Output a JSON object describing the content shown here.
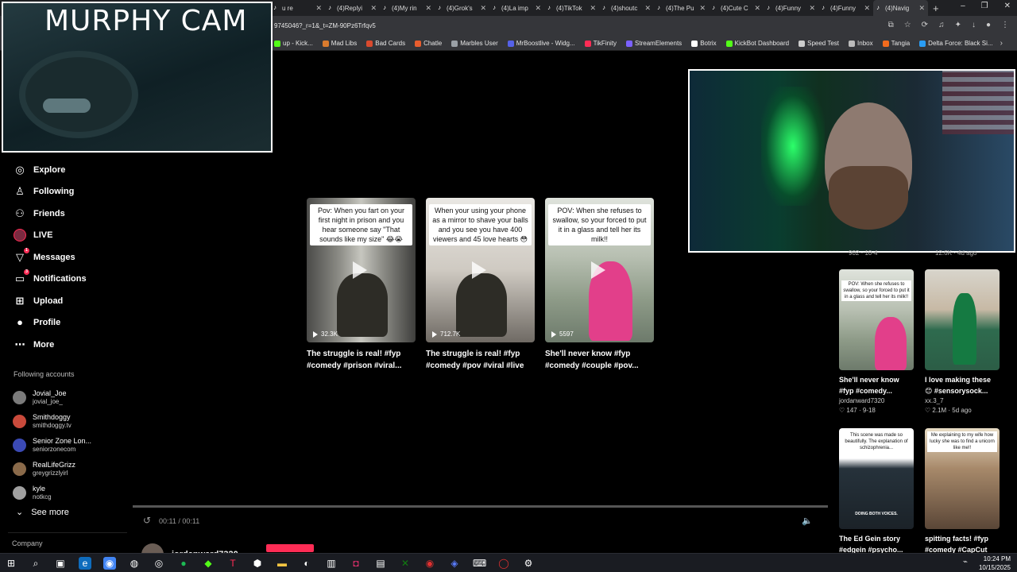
{
  "browser": {
    "tabs": [
      {
        "title": "u re"
      },
      {
        "title": "(4)Replyi"
      },
      {
        "title": "(4)My rin"
      },
      {
        "title": "(4)Grok's"
      },
      {
        "title": "(4)La imp"
      },
      {
        "title": "(4)TikTok"
      },
      {
        "title": "(4)shoutc"
      },
      {
        "title": "(4)The Pu"
      },
      {
        "title": "(4)Cute C"
      },
      {
        "title": "(4)Funny"
      },
      {
        "title": "(4)Funny"
      },
      {
        "title": "(4)Navig"
      }
    ],
    "url": "9745046?_r=1&_t=ZM-90Pz6Trfqv5",
    "bookmarks": [
      {
        "label": "up - Kick...",
        "color": "#53fc18"
      },
      {
        "label": "Mad Libs",
        "color": "#d97b2e"
      },
      {
        "label": "Bad Cards",
        "color": "#d94a2e"
      },
      {
        "label": "Chatle",
        "color": "#e85d2e"
      },
      {
        "label": "Marbles User",
        "color": "#9aa0a6"
      },
      {
        "label": "MrBoostlive - Widg...",
        "color": "#5561e8"
      },
      {
        "label": "TikFinity",
        "color": "#fe2c55"
      },
      {
        "label": "StreamElements",
        "color": "#7b61ff"
      },
      {
        "label": "Botrix",
        "color": "#ffffff"
      },
      {
        "label": "KickBot Dashboard",
        "color": "#53fc18"
      },
      {
        "label": "Speed Test",
        "color": "#cccccc"
      },
      {
        "label": "Inbox",
        "color": "#bbbbbb"
      },
      {
        "label": "Tangia",
        "color": "#f26b1d"
      },
      {
        "label": "Delta Force: Black Si...",
        "color": "#2a9df4"
      }
    ]
  },
  "overlay": {
    "murphy_label": "MURPHY CAM"
  },
  "nav": {
    "items": [
      {
        "label": "Explore",
        "icon": "compass-icon",
        "glyph": "◎"
      },
      {
        "label": "Following",
        "icon": "following-icon",
        "glyph": "♙"
      },
      {
        "label": "Friends",
        "icon": "friends-icon",
        "glyph": "⚇"
      },
      {
        "label": "LIVE",
        "icon": "live-icon",
        "glyph": ""
      },
      {
        "label": "Messages",
        "icon": "messages-icon",
        "glyph": "▽",
        "badge": "1"
      },
      {
        "label": "Notifications",
        "icon": "notifications-icon",
        "glyph": "▭",
        "badge": "3"
      },
      {
        "label": "Upload",
        "icon": "upload-icon",
        "glyph": "⊞"
      },
      {
        "label": "Profile",
        "icon": "profile-icon",
        "glyph": "●"
      },
      {
        "label": "More",
        "icon": "more-icon",
        "glyph": "⋯"
      }
    ],
    "following_title": "Following accounts",
    "following": [
      {
        "name": "Jovial_Joe",
        "user": "jovial_joe_",
        "color": "#7b7b7b"
      },
      {
        "name": "Smithdoggy",
        "user": "smithdoggy.tv",
        "color": "#c94a3b"
      },
      {
        "name": "Senior Zone Lon...",
        "user": "seniorzonecom",
        "color": "#3b4ab5"
      },
      {
        "name": "RealLifeGrizz",
        "user": "greygrizzlyirl",
        "color": "#8a6a4a"
      },
      {
        "name": "kyle",
        "user": "notkcg",
        "color": "#a0a0a0"
      }
    ],
    "see_more": "See more",
    "company": "Company"
  },
  "videos": [
    {
      "caption": "Pov: When you fart on your first night in prison and you hear someone say \"That sounds like my size\" 😂😭",
      "count": "32.3K",
      "desc": "The struggle is real! #fyp #comedy #prison #viral..."
    },
    {
      "caption": "When your using your phone as a mirror to shave your balls and you see you have 400 viewers and 45 love hearts 😳",
      "count": "712.7K",
      "desc": "The struggle is real! #fyp #comedy #pov #viral #live"
    },
    {
      "caption": "POV: When she refuses to swallow, so your forced to put it in a glass and tell her its milk!!",
      "count": "5597",
      "desc": "She'll never know #fyp #comedy #couple #pov..."
    }
  ],
  "player": {
    "time": "00:11 / 00:11",
    "author": "jordanward7320"
  },
  "recommended": {
    "partial_top_left": "902 · 10-4",
    "partial_top_right": "12.6K · 4d ago",
    "items": [
      {
        "caption": "POV: When she refuses to swallow, so your forced to put it in a glass and tell her its milk!!",
        "desc": "She'll never know #fyp #comedy...",
        "user": "jordanward7320",
        "stats": "♡ 147 · 9-18"
      },
      {
        "caption": "",
        "desc": "I love making these 😊 #sensorysock...",
        "user": "xx.3_7",
        "stats": "♡ 2.1M · 5d ago"
      },
      {
        "caption": "This scene was made so beautifully. The explanation of schizophrenia...",
        "desc": "The Ed Gein story #edgein #psycho...",
        "user": "",
        "stats": ""
      },
      {
        "caption": "Me explaining to my wife how lucky she was to find a unicorn like me!!",
        "desc": "spitting facts! #fyp #comedy #CapCut",
        "user": "",
        "stats": ""
      }
    ],
    "meme_tag": "DOING BOTH VOICES."
  },
  "taskbar": {
    "time": "10:24 PM",
    "date": "10/15/2025"
  },
  "colors": {
    "accent": "#fe2c55",
    "background": "#000000"
  }
}
